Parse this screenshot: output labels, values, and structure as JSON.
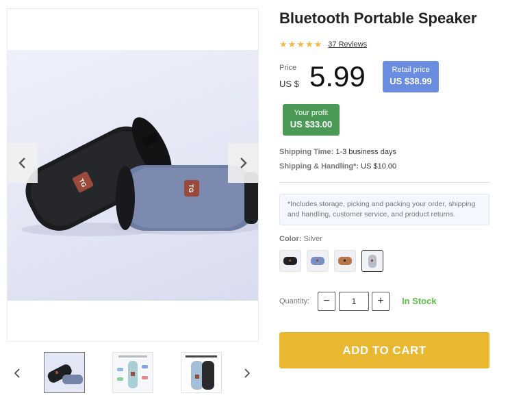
{
  "product": {
    "title": "Bluetooth Portable Speaker",
    "rating": 5,
    "reviews_label": "37 Reviews"
  },
  "price": {
    "label": "Price",
    "currency": "US $",
    "value": "5.99"
  },
  "retail": {
    "label": "Retail price",
    "value": "US $38.99"
  },
  "profit": {
    "label": "Your profit",
    "value": "US $33.00"
  },
  "shipping": {
    "time_label": "Shipping Time:",
    "time_value": "1-3 business days",
    "handling_label": "Shipping & Handling*:",
    "handling_value": "US $10.00"
  },
  "note": "*Includes storage, picking and packing your order, shipping and handling, customer service, and product returns.",
  "color": {
    "label": "Color:",
    "selected": "Silver",
    "options": [
      "Black",
      "Blue",
      "Brown",
      "Silver"
    ]
  },
  "quantity": {
    "label": "Quantity:",
    "value": "1",
    "minus": "−",
    "plus": "+"
  },
  "stock_status": "In Stock",
  "add_to_cart": "ADD TO CART",
  "gallery": {
    "thumbnail_count": 3,
    "active_thumbnail": 1
  },
  "colors": {
    "retail_bg": "#6b8de1",
    "profit_bg": "#4a9a56",
    "cart_bg": "#eab830",
    "stock_text": "#5cbf4a",
    "star": "#f4b942"
  },
  "icons": [
    "chevron-left-icon",
    "chevron-right-icon",
    "star-icon"
  ]
}
